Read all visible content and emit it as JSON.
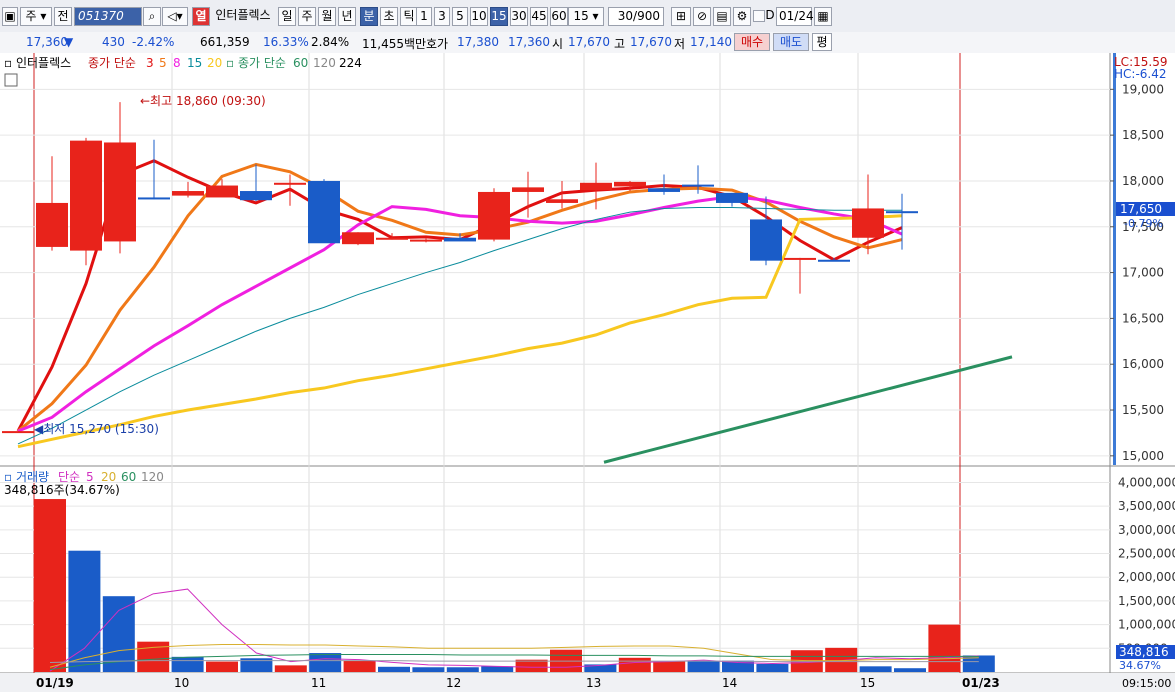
{
  "toolbar": {
    "market": "주",
    "prev_label": "전",
    "code": "051370",
    "stock_name": "인터플렉스",
    "watch_label": "열",
    "periods": [
      "일",
      "주",
      "월",
      "년",
      "분",
      "초",
      "틱"
    ],
    "selected_period": "분",
    "intervals": [
      "1",
      "3",
      "5",
      "10",
      "15",
      "30",
      "45",
      "60"
    ],
    "selected_interval": "15",
    "interval_select": "15",
    "count": "30/900",
    "date_input": "01/24",
    "d_label": "D"
  },
  "quote": {
    "price": "17,360",
    "change": "430",
    "change_pct": "-2.42%",
    "volume": "661,359",
    "turnover_pct": "16.33%",
    "ratio": "2.84%",
    "amount": "11,455백만",
    "hoga_label": "호가",
    "ask": "17,380",
    "bid": "17,360",
    "open_label": "시",
    "open": "17,670",
    "high_label": "고",
    "high": "17,670",
    "low_label": "저",
    "low": "17,140",
    "buy_label": "매수",
    "sell_label": "매도",
    "even_label": "평"
  },
  "price_legend": {
    "name": "인터플렉스",
    "ma_label": "종가 단순",
    "ma_periods": [
      "3",
      "5",
      "8",
      "15",
      "20"
    ],
    "ma2_label": "종가 단순",
    "ma2_periods": [
      "60",
      "120",
      "224"
    ]
  },
  "volume_legend": {
    "name": "거래량",
    "ma_label": "단순",
    "ma_periods": [
      "5",
      "20",
      "60",
      "120"
    ],
    "current": "348,816주(34.67%)"
  },
  "annotations": {
    "high": "최고 18,860 (09:30)",
    "low": "최저 15,270 (15:30)",
    "lc": "LC:15.59",
    "hc": "HC:-6.42",
    "last_price": "17,650",
    "last_pct": "-0.79%",
    "last_volume": "348,816",
    "last_volume_pct": "34.67%"
  },
  "colors": {
    "up": "#e8231b",
    "down": "#1a5cc8",
    "ma3": "#e01010",
    "ma5": "#f07818",
    "ma8": "#f020e0",
    "ma15": "#0a8c9c",
    "ma20": "#f8c820",
    "ma60": "#2a9060"
  },
  "chart_data": [
    {
      "type": "candlestick",
      "title": "인터플렉스 15분",
      "x": [
        "01/19 15:30",
        "01/20 09:00",
        "01/20 09:30",
        "01/20 10:00",
        "01/20 10:30",
        "01/20 11:00",
        "01/20 12:00",
        "01/20 13:30",
        "01/21 09:30",
        "01/21 10:30",
        "01/21 11:30",
        "01/21 12:30",
        "01/22 09:30",
        "01/22 10:30",
        "01/22 11:30",
        "01/22 12:30",
        "01/22 13:30",
        "01/22 14:30",
        "01/22 15:30",
        "01/23 09:30",
        "01/23 10:30",
        "01/23 11:30",
        "01/23 13:00",
        "01/23 14:00",
        "01/23 15:00",
        "01/24 09:00",
        "01/24 09:15"
      ],
      "open": [
        15270,
        17280,
        17240,
        17340,
        17820,
        17840,
        17820,
        17890,
        17980,
        18000,
        17310,
        17360,
        17360,
        17380,
        17360,
        17880,
        17760,
        17900,
        17940,
        17920,
        17960,
        17870,
        17580,
        17150,
        17140,
        17380,
        17670
      ],
      "high": [
        15270,
        18270,
        18470,
        18860,
        18450,
        17990,
        18020,
        18180,
        18070,
        18020,
        17440,
        17430,
        17370,
        17430,
        17920,
        18100,
        18000,
        18200,
        18000,
        18070,
        18170,
        17870,
        17830,
        17160,
        17160,
        18070,
        17860
      ],
      "low": [
        15270,
        17240,
        17080,
        17210,
        17800,
        17820,
        17900,
        17780,
        17730,
        17350,
        17300,
        17360,
        17330,
        17350,
        17340,
        17600,
        17700,
        17690,
        17890,
        17850,
        17860,
        17720,
        17080,
        16770,
        17130,
        17200,
        17250
      ],
      "close": [
        15270,
        17760,
        18440,
        18420,
        17800,
        17890,
        17950,
        17790,
        17980,
        17320,
        17440,
        17380,
        17360,
        17340,
        17880,
        17930,
        17800,
        17980,
        17990,
        17880,
        17940,
        17760,
        17130,
        17160,
        17130,
        17700,
        17650
      ],
      "ylim": [
        14900,
        19200
      ],
      "yticks": [
        "15,000",
        "15,500",
        "16,000",
        "16,500",
        "17,000",
        "17,500",
        "18,000",
        "18,500",
        "19,000"
      ],
      "xticks": [
        "01/19",
        "10",
        "11",
        "12",
        "13",
        "14",
        "15",
        "01/23"
      ],
      "series": [
        {
          "name": "3",
          "values": [
            15270,
            15970,
            16880,
            18070,
            18220,
            18040,
            17880,
            17760,
            17910,
            17690,
            17580,
            17380,
            17390,
            17360,
            17530,
            17720,
            17870,
            17900,
            17920,
            17950,
            17930,
            17830,
            17610,
            17350,
            17140,
            17330,
            17490
          ]
        },
        {
          "name": "5",
          "values": [
            15270,
            15570,
            15990,
            16590,
            17060,
            17620,
            18050,
            18180,
            18100,
            17910,
            17670,
            17570,
            17440,
            17410,
            17470,
            17550,
            17680,
            17790,
            17880,
            17910,
            17920,
            17900,
            17770,
            17560,
            17390,
            17270,
            17360
          ]
        },
        {
          "name": "8",
          "values": [
            15270,
            15420,
            15700,
            15950,
            16200,
            16420,
            16650,
            16850,
            17050,
            17250,
            17520,
            17720,
            17690,
            17620,
            17600,
            17560,
            17540,
            17560,
            17630,
            17710,
            17780,
            17830,
            17790,
            17710,
            17640,
            17580,
            17420
          ]
        },
        {
          "name": "20",
          "values": [
            15100,
            15180,
            15260,
            15340,
            15430,
            15500,
            15560,
            15620,
            15690,
            15740,
            15820,
            15880,
            15950,
            16020,
            16090,
            16170,
            16230,
            16320,
            16450,
            16540,
            16650,
            16720,
            16730,
            17580,
            17590,
            17600,
            17620
          ]
        }
      ]
    },
    {
      "type": "bar",
      "title": "거래량",
      "values": [
        3650000,
        2560000,
        1600000,
        640000,
        320000,
        220000,
        290000,
        140000,
        400000,
        240000,
        110000,
        100000,
        100000,
        120000,
        260000,
        470000,
        160000,
        300000,
        230000,
        230000,
        240000,
        170000,
        460000,
        510000,
        120000,
        80000,
        1000000,
        348816
      ],
      "ylim": [
        0,
        4200000
      ],
      "yticks": [
        "500,000",
        "1,000,000",
        "1,500,000",
        "2,000,000",
        "2,500,000",
        "3,000,000",
        "3,500,000",
        "4,000,000"
      ],
      "xlabel_time": "09:15:00"
    }
  ]
}
